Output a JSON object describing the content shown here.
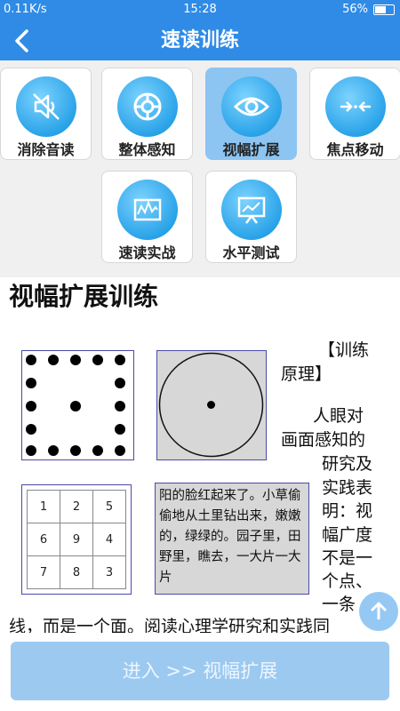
{
  "status": {
    "network": "0.11K/s",
    "time": "15:28",
    "battery": "56%"
  },
  "header": {
    "title": "速读训练"
  },
  "menu": [
    {
      "label": "消除音读",
      "icon": "mute-speaker-icon",
      "active": false
    },
    {
      "label": "整体感知",
      "icon": "lifebuoy-icon",
      "active": false
    },
    {
      "label": "视幅扩展",
      "icon": "eye-icon",
      "active": true
    },
    {
      "label": "焦点移动",
      "icon": "focus-arrows-icon",
      "active": false
    },
    {
      "label": "速读实战",
      "icon": "book-chart-icon",
      "active": false
    },
    {
      "label": "水平测试",
      "icon": "presentation-board-icon",
      "active": false
    }
  ],
  "content": {
    "title": "视幅扩展训练",
    "principle_head_1": "【训练",
    "principle_head_2": "原理】",
    "body_lines": [
      "人眼对",
      "画面感知的",
      "研究及",
      "实践表",
      "明：视",
      "幅广度",
      "不是一",
      "个点、",
      "一条"
    ],
    "bottom_line": "线，而是一个面。阅读心理学研究和实践同",
    "number_grid": [
      [
        "1",
        "2",
        "5"
      ],
      [
        "6",
        "9",
        "4"
      ],
      [
        "7",
        "8",
        "3"
      ]
    ],
    "sample_text": "阳的脸红起来了。小草偷偷地从土里钻出来，嫩嫩的，绿绿的。园子里，田野里，瞧去，一大片一大片"
  },
  "footer": {
    "enter_label": "进入 >> 视幅扩展"
  },
  "colors": {
    "primary": "#2f8be6",
    "active_tile": "#8cc4f2",
    "button": "#9cc9f0"
  }
}
